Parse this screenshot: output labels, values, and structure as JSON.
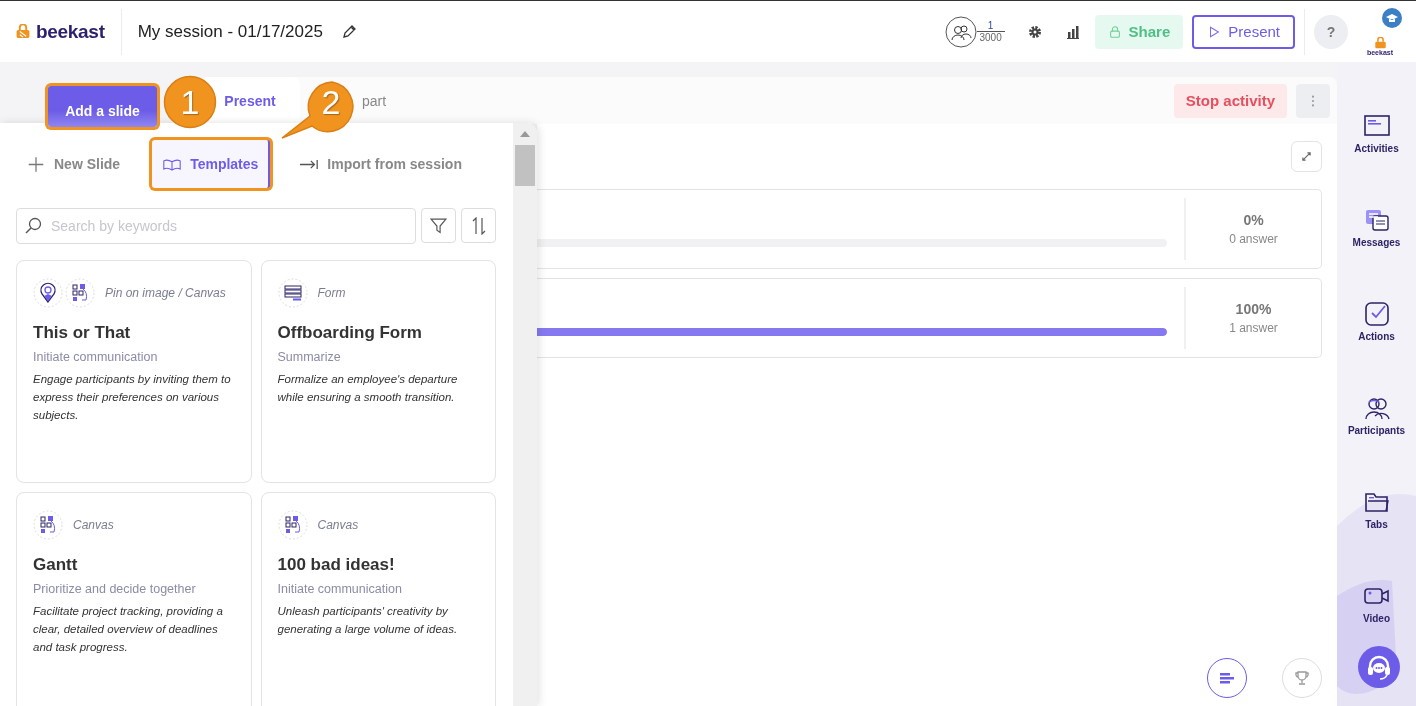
{
  "header": {
    "logo": "beekast",
    "session_title": "My session - 01/17/2025",
    "participants": {
      "count": "1",
      "capacity": "3000"
    },
    "share_button": "Share",
    "present_button": "Present",
    "help_button": "?",
    "account_logo": "beekast"
  },
  "add_slide_button": {
    "label": "Add a slide",
    "highlighted": true
  },
  "tabs": [
    {
      "label": "Present",
      "selected": true
    },
    {
      "label": "part",
      "selected": false
    }
  ],
  "stop_button": "Stop activity",
  "results": [
    {
      "percent": "0%",
      "answers": "0 answer",
      "level": 0
    },
    {
      "percent": "100%",
      "answers": "1 answer",
      "level": 1
    }
  ],
  "panel": {
    "modes": [
      {
        "kind": "new",
        "label": "New Slide",
        "selected": false,
        "highlighted": false
      },
      {
        "kind": "templates",
        "label": "Templates",
        "selected": true,
        "highlighted": true
      },
      {
        "kind": "import",
        "label": "Import from session",
        "selected": false,
        "highlighted": false
      }
    ],
    "search": {
      "placeholder": "Search by keywords"
    },
    "templates": [
      {
        "icons": [
          {
            "kind": "pin"
          },
          {
            "kind": "canvas"
          }
        ],
        "category": "Pin on image /  Canvas",
        "title": "This or That",
        "subtitle": "Initiate communication",
        "description": "Engage participants by inviting them to express their preferences on various subjects."
      },
      {
        "icons": [
          {
            "kind": "form"
          }
        ],
        "category": "Form",
        "title": "Offboarding Form",
        "subtitle": "Summarize",
        "description": "Formalize an employee's departure while ensuring a smooth transition."
      },
      {
        "icons": [
          {
            "kind": "canvas"
          }
        ],
        "category": "Canvas",
        "title": "Gantt",
        "subtitle": "Prioritize and decide together",
        "description": "Facilitate project tracking, providing a clear, detailed overview of deadlines and task progress."
      },
      {
        "icons": [
          {
            "kind": "canvas"
          }
        ],
        "category": "Canvas",
        "title": "100 bad ideas!",
        "subtitle": "Initiate communication",
        "description": "Unleash participants' creativity by generating a large volume of ideas."
      }
    ]
  },
  "sidebar": [
    {
      "kind": "activities",
      "label": "Activities"
    },
    {
      "kind": "messages",
      "label": "Messages"
    },
    {
      "kind": "actions",
      "label": "Actions"
    },
    {
      "kind": "participants",
      "label": "Participants"
    },
    {
      "kind": "tabs",
      "label": "Tabs"
    },
    {
      "kind": "video",
      "label": "Video"
    }
  ],
  "callouts": [
    {
      "number": "1"
    },
    {
      "number": "2"
    }
  ]
}
